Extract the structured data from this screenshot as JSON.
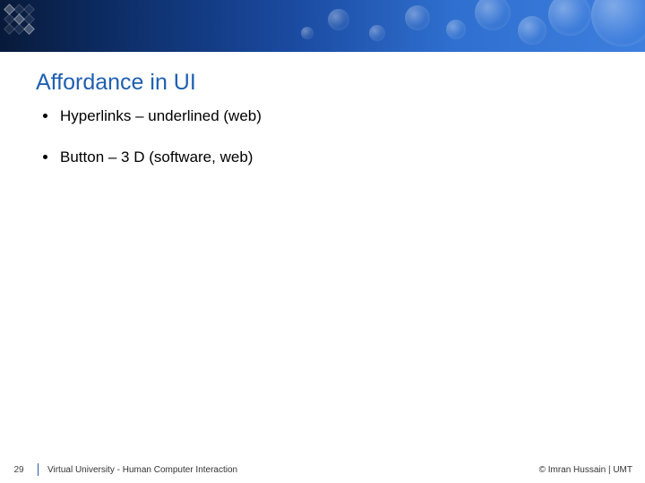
{
  "title": "Affordance in UI",
  "bullets": {
    "items": [
      {
        "text": "Hyperlinks – underlined (web)"
      },
      {
        "text": "Button – 3 D (software, web)"
      }
    ]
  },
  "footer": {
    "page": "29",
    "center": "Virtual University - Human Computer Interaction",
    "right": "© Imran Hussain | UMT"
  },
  "colors": {
    "title": "#1f5fb0",
    "band_dark": "#081a3a",
    "band_light": "#3e7fde"
  }
}
